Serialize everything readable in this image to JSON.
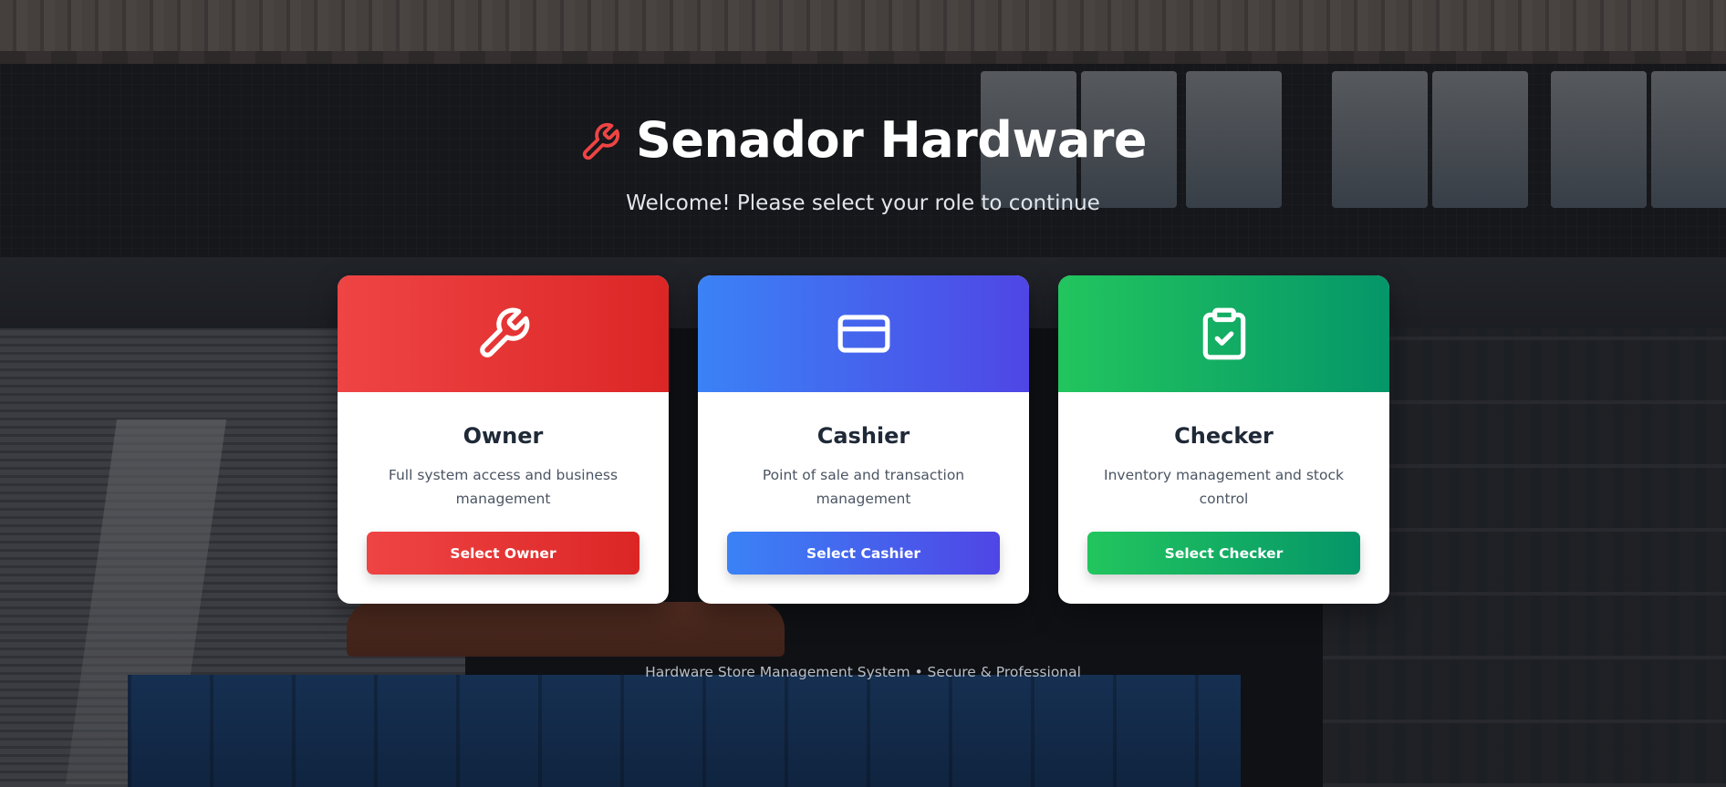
{
  "header": {
    "title": "Senador Hardware",
    "subtitle": "Welcome! Please select your role to continue",
    "logo_icon": "wrench-icon",
    "logo_color": "#ef4444"
  },
  "roles": [
    {
      "id": "owner",
      "title": "Owner",
      "description": "Full system access and business management",
      "button_label": "Select Owner",
      "icon": "wrench-icon",
      "color_start": "#ef4444",
      "color_end": "#dc2626"
    },
    {
      "id": "cashier",
      "title": "Cashier",
      "description": "Point of sale and transaction management",
      "button_label": "Select Cashier",
      "icon": "credit-card-icon",
      "color_start": "#3b82f6",
      "color_end": "#4f46e5"
    },
    {
      "id": "checker",
      "title": "Checker",
      "description": "Inventory management and stock control",
      "button_label": "Select Checker",
      "icon": "clipboard-check-icon",
      "color_start": "#22c55e",
      "color_end": "#059669"
    }
  ],
  "footer": {
    "text": "Hardware Store Management System • Secure & Professional"
  }
}
